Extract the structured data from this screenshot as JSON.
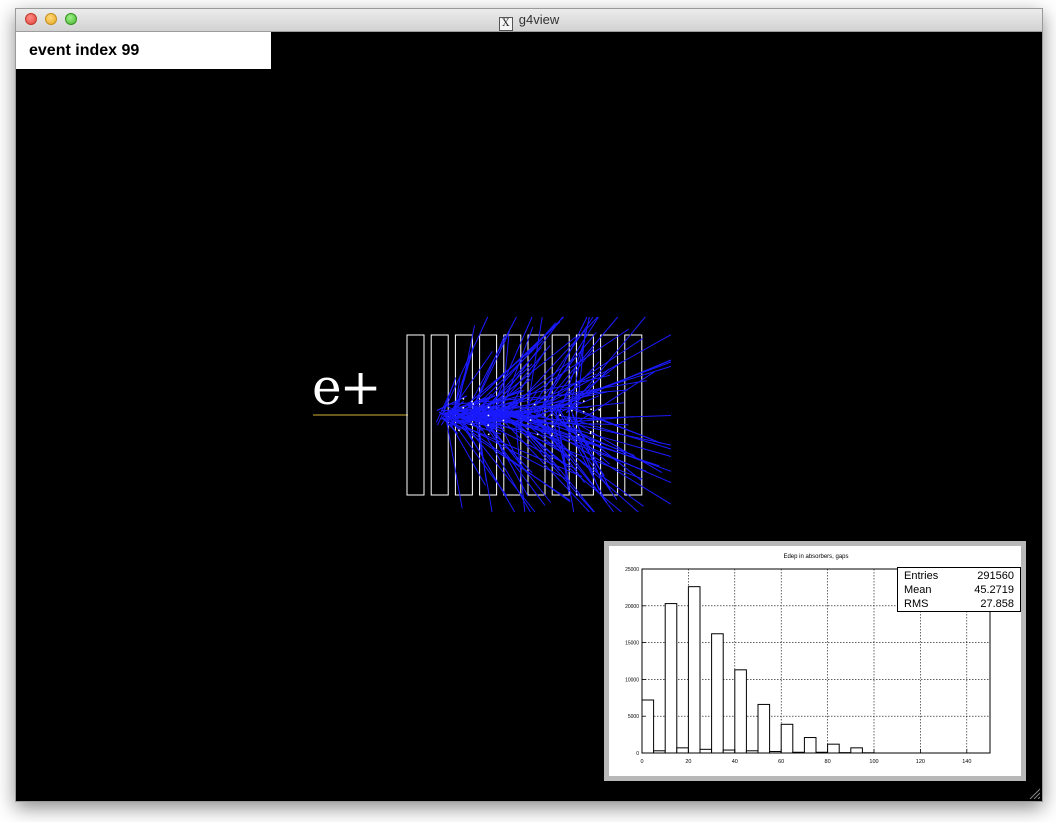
{
  "window": {
    "title": "g4view",
    "app_icon": "x11-icon"
  },
  "overlay": {
    "event_label": "event index 99"
  },
  "particle": {
    "label": "e+",
    "beam_color": "#d4b23a",
    "track_color": "#1a1aff"
  },
  "detector": {
    "layers": 10,
    "outline_color": "#ffffff"
  },
  "stats": {
    "entries_label": "Entries",
    "entries_value": "291560",
    "mean_label": "Mean",
    "mean_value": "45.2719",
    "rms_label": "RMS",
    "rms_value": "27.858"
  },
  "chart_data": {
    "type": "bar",
    "title": "Edep in absorbers, gaps",
    "xlim": [
      0,
      150
    ],
    "ylim": [
      0,
      25000
    ],
    "xticks": [
      0,
      20,
      40,
      60,
      80,
      100,
      120,
      140
    ],
    "xtick_labels": [
      "0",
      "20",
      "40",
      "60",
      "80",
      "100",
      "120",
      "140"
    ],
    "yticks": [
      0,
      5000,
      10000,
      15000,
      20000,
      25000
    ],
    "ytick_labels": [
      "0",
      "5000",
      "10000",
      "15000",
      "20000",
      "25000"
    ],
    "grid": true,
    "bin_width": 5,
    "bin_edges": [
      0,
      5,
      10,
      15,
      20,
      25,
      30,
      35,
      40,
      45,
      50,
      55,
      60,
      65,
      70,
      75,
      80,
      85,
      90,
      95,
      100,
      105,
      110,
      115,
      120,
      125,
      130,
      135,
      140,
      145
    ],
    "values": [
      7200,
      300,
      20300,
      700,
      22600,
      500,
      16200,
      400,
      11300,
      300,
      6600,
      200,
      3900,
      100,
      2100,
      100,
      1200,
      50,
      700,
      30,
      0,
      0,
      0,
      0,
      0,
      0,
      0,
      0,
      0,
      0
    ]
  }
}
